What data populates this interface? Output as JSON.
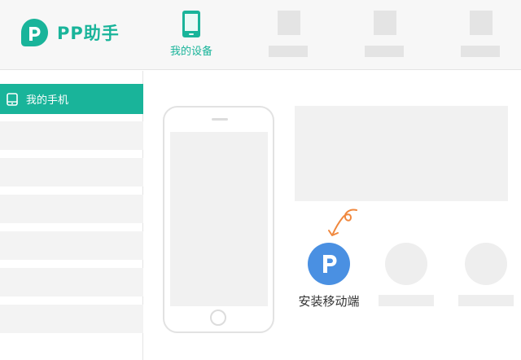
{
  "app": {
    "name": "PP助手",
    "brand_color": "#19b49a",
    "logo_icon": "pp-logo-icon"
  },
  "nav": {
    "active_tab": {
      "label": "我的设备",
      "icon": "phone-icon"
    }
  },
  "sidebar": {
    "active_item": {
      "label": "我的手机",
      "icon": "tablet-icon"
    }
  },
  "main": {
    "install_mobile": {
      "label": "安装移动端",
      "icon": "pp-app-icon",
      "icon_color": "#4a90e2",
      "hint_color": "#f0883e"
    }
  }
}
